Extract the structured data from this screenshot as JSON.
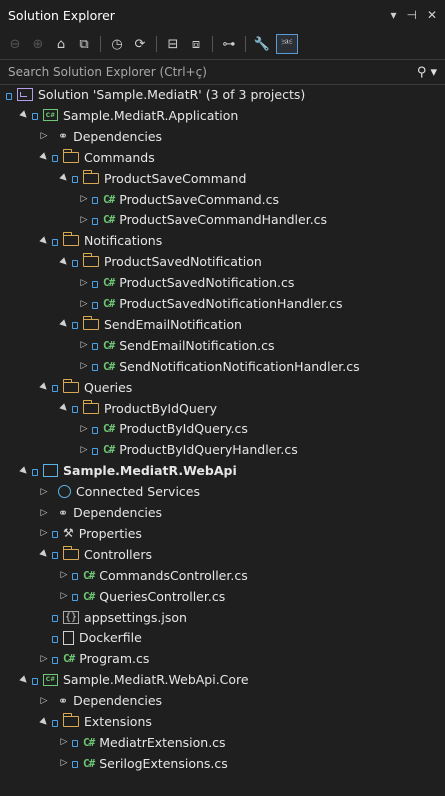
{
  "window": {
    "title": "Solution Explorer",
    "controls": [
      "▾",
      "⊣",
      "✕"
    ]
  },
  "toolbar": {
    "buttons": [
      {
        "icon": "back-arrow-icon",
        "glyph": "⊖",
        "enabled": false
      },
      {
        "icon": "forward-arrow-icon",
        "glyph": "⊕",
        "enabled": false
      },
      {
        "icon": "home-icon",
        "glyph": "⌂",
        "enabled": true
      },
      {
        "icon": "switch-views-icon",
        "glyph": "⧉",
        "enabled": true
      },
      {
        "icon": "history-icon",
        "glyph": "◷",
        "enabled": true
      },
      {
        "icon": "sync-icon",
        "glyph": "⟳",
        "enabled": true
      },
      {
        "icon": "collapse-all-icon",
        "glyph": "⊟",
        "enabled": true
      },
      {
        "icon": "show-all-files-icon",
        "glyph": "⧈",
        "enabled": true
      },
      {
        "icon": "filter-icon",
        "glyph": "⊶",
        "enabled": true
      },
      {
        "icon": "properties-wrench-icon",
        "glyph": "🔧",
        "enabled": true
      },
      {
        "icon": "preview-icon",
        "glyph": "⎃",
        "enabled": true
      }
    ]
  },
  "search": {
    "placeholder": "Search Solution Explorer (Ctrl+ç)",
    "value": ""
  },
  "tree": [
    {
      "label": "Solution 'Sample.MediatR' (3 of 3 projects)",
      "depth": 0,
      "exp": "",
      "icon": "solution",
      "lock": true,
      "bold": false
    },
    {
      "label": "Sample.MediatR.Application",
      "depth": 1,
      "exp": "▲",
      "icon": "project",
      "lock": true,
      "bold": false
    },
    {
      "label": "Dependencies",
      "depth": 2,
      "exp": "▷",
      "icon": "dependencies",
      "lock": false,
      "bold": false
    },
    {
      "label": "Commands",
      "depth": 2,
      "exp": "▲",
      "icon": "folder",
      "lock": true,
      "bold": false
    },
    {
      "label": "ProductSaveCommand",
      "depth": 3,
      "exp": "▲",
      "icon": "folder",
      "lock": true,
      "bold": false
    },
    {
      "label": "ProductSaveCommand.cs",
      "depth": 4,
      "exp": "▷",
      "icon": "csharp",
      "lock": true,
      "bold": false
    },
    {
      "label": "ProductSaveCommandHandler.cs",
      "depth": 4,
      "exp": "▷",
      "icon": "csharp",
      "lock": true,
      "bold": false
    },
    {
      "label": "Notifications",
      "depth": 2,
      "exp": "▲",
      "icon": "folder",
      "lock": true,
      "bold": false
    },
    {
      "label": "ProductSavedNotification",
      "depth": 3,
      "exp": "▲",
      "icon": "folder",
      "lock": true,
      "bold": false
    },
    {
      "label": "ProductSavedNotification.cs",
      "depth": 4,
      "exp": "▷",
      "icon": "csharp",
      "lock": true,
      "bold": false
    },
    {
      "label": "ProductSavedNotificationHandler.cs",
      "depth": 4,
      "exp": "▷",
      "icon": "csharp",
      "lock": true,
      "bold": false
    },
    {
      "label": "SendEmailNotification",
      "depth": 3,
      "exp": "▲",
      "icon": "folder",
      "lock": true,
      "bold": false
    },
    {
      "label": "SendEmailNotification.cs",
      "depth": 4,
      "exp": "▷",
      "icon": "csharp",
      "lock": true,
      "bold": false
    },
    {
      "label": "SendNotificationNotificationHandler.cs",
      "depth": 4,
      "exp": "▷",
      "icon": "csharp",
      "lock": true,
      "bold": false
    },
    {
      "label": "Queries",
      "depth": 2,
      "exp": "▲",
      "icon": "folder",
      "lock": true,
      "bold": false
    },
    {
      "label": "ProductByIdQuery",
      "depth": 3,
      "exp": "▲",
      "icon": "folder",
      "lock": true,
      "bold": false
    },
    {
      "label": "ProductByIdQuery.cs",
      "depth": 4,
      "exp": "▷",
      "icon": "csharp",
      "lock": true,
      "bold": false
    },
    {
      "label": "ProductByIdQueryHandler.cs",
      "depth": 4,
      "exp": "▷",
      "icon": "csharp",
      "lock": true,
      "bold": false
    },
    {
      "label": "Sample.MediatR.WebApi",
      "depth": 1,
      "exp": "▲",
      "icon": "webproject",
      "lock": true,
      "bold": true
    },
    {
      "label": "Connected Services",
      "depth": 2,
      "exp": "▷",
      "icon": "connected",
      "lock": false,
      "bold": false
    },
    {
      "label": "Dependencies",
      "depth": 2,
      "exp": "▷",
      "icon": "dependencies",
      "lock": false,
      "bold": false
    },
    {
      "label": "Properties",
      "depth": 2,
      "exp": "▷",
      "icon": "properties",
      "lock": true,
      "bold": false
    },
    {
      "label": "Controllers",
      "depth": 2,
      "exp": "▲",
      "icon": "folder",
      "lock": true,
      "bold": false
    },
    {
      "label": "CommandsController.cs",
      "depth": 3,
      "exp": "▷",
      "icon": "csharp",
      "lock": true,
      "bold": false
    },
    {
      "label": "QueriesController.cs",
      "depth": 3,
      "exp": "▷",
      "icon": "csharp",
      "lock": true,
      "bold": false
    },
    {
      "label": "appsettings.json",
      "depth": 2,
      "exp": "",
      "icon": "json",
      "lock": true,
      "bold": false
    },
    {
      "label": "Dockerfile",
      "depth": 2,
      "exp": "",
      "icon": "file",
      "lock": true,
      "bold": false
    },
    {
      "label": "Program.cs",
      "depth": 2,
      "exp": "▷",
      "icon": "csharp",
      "lock": true,
      "bold": false
    },
    {
      "label": "Sample.MediatR.WebApi.Core",
      "depth": 1,
      "exp": "▲",
      "icon": "project",
      "lock": true,
      "bold": false
    },
    {
      "label": "Dependencies",
      "depth": 2,
      "exp": "▷",
      "icon": "dependencies",
      "lock": false,
      "bold": false
    },
    {
      "label": "Extensions",
      "depth": 2,
      "exp": "▲",
      "icon": "folder",
      "lock": true,
      "bold": false
    },
    {
      "label": "MediatrExtension.cs",
      "depth": 3,
      "exp": "▷",
      "icon": "csharp",
      "lock": true,
      "bold": false
    },
    {
      "label": "SerilogExtensions.cs",
      "depth": 3,
      "exp": "▷",
      "icon": "csharp",
      "lock": true,
      "bold": false
    }
  ],
  "colors": {
    "background": "#1f1f1f",
    "text": "#e6e6e6",
    "folder": "#d8a94e",
    "csharp": "#6ec776",
    "lock": "#4aa3e8"
  }
}
